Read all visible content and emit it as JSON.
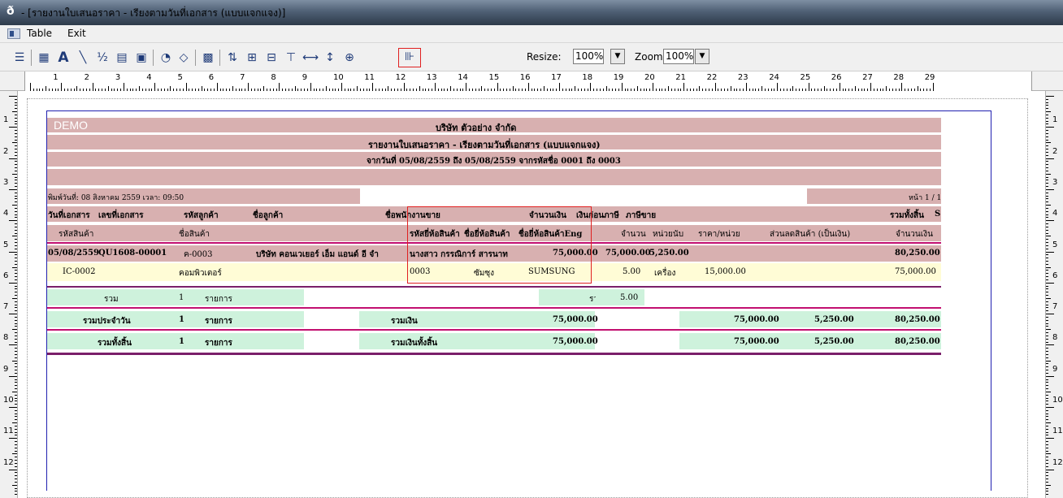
{
  "window": {
    "title": "- [รายงานใบเสนอราคา - เรียงตามวันที่เอกสาร (แบบแจกแจง)]"
  },
  "menu": {
    "items": [
      "Table",
      "Exit"
    ]
  },
  "toolbar": {
    "resize_label": "Resize:",
    "resize_value": "100%",
    "zoom_label": "Zoom:",
    "zoom_value": "100%",
    "icons": [
      "align-icon",
      "table-icon",
      "text-icon",
      "line-icon",
      "percent-icon",
      "grid-icon",
      "image-icon",
      "chart-icon",
      "eraser-icon",
      "picture-icon",
      "sort-icon",
      "group-icon",
      "field-icon",
      "column-icon",
      "width-icon",
      "height-icon",
      "fit-icon",
      "exit-icon"
    ]
  },
  "ruler": {
    "marks": [
      "1",
      "2",
      "3",
      "4",
      "5",
      "6",
      "7",
      "8",
      "9",
      "10",
      "11",
      "12",
      "13",
      "14",
      "15",
      "16",
      "17",
      "18",
      "19",
      "20",
      "21",
      "22",
      "23",
      "24",
      "25",
      "26",
      "27",
      "28",
      "29"
    ],
    "vmarks": [
      "1",
      "2",
      "3",
      "4",
      "5",
      "6",
      "7",
      "8",
      "9",
      "10",
      "11",
      "12"
    ]
  },
  "report": {
    "watermark": "DEMO",
    "company": "บริษัท ตัวอย่าง จำกัด",
    "title": "รายงานใบเสนอราคา - เรียงตามวันที่เอกสาร (แบบแจกแจง)",
    "range": "จากวันที่ 05/08/2559 ถึง 05/08/2559 จากรหัสชื่อ 0001 ถึง 0003",
    "print_date": "พิมพ์วันที่: 08 สิงหาคม 2559 เวลา: 09:50",
    "page": "หน้า 1 / 1",
    "header1": {
      "doc_date": "วันที่เอกสาร",
      "doc_no": "เลขที่เอกสาร",
      "cust_code": "รหัสลูกค้า",
      "cust_name": "ชื่อลูกค้า",
      "salesperson": "ชื่อพนักงานขาย",
      "amount": "จำนวนเงิน",
      "before_tax": "เงินก่อนภาษี",
      "tax": "ภาษีขาย",
      "total": "รวมทั้งสิ้น",
      "s": "S"
    },
    "header2": {
      "item_code": "รหัสสินค้า",
      "item_name": "ชื่อสินค้า",
      "brand_code": "รหัสยี่ห้อสินค้า",
      "brand_name": "ชื่อยี่ห้อสินค้า",
      "brand_name_eng": "ชื่อยี่ห้อสินค้าEng",
      "qty": "จำนวน",
      "unit": "หน่วยนับ",
      "price": "ราคา/หน่วย",
      "discount": "ส่วนลดสินค้า (เป็นเงิน)",
      "line_amount": "จำนวนเงิน"
    },
    "doc_row": {
      "date": "05/08/2559",
      "no": "QU1608-00001",
      "cust_code": "ค-0003",
      "cust_name": "บริษัท คอนเวเยอร์ เอ็ม แอนด์ อี จำ",
      "salesperson": "นางสาว กรรณิการ์ สารนาท",
      "amount": "75,000.00",
      "before_tax": "75,000.00",
      "tax": "5,250.00",
      "total": "80,250.00"
    },
    "item_row": {
      "code": "IC-0002",
      "name": "คอมพิวเตอร์",
      "brand_code": "0003",
      "brand_name": "ซัมซุง",
      "brand_name_eng": "SUMSUNG",
      "qty": "5.00",
      "unit": "เครื่อง",
      "price": "15,000.00",
      "amount": "75,000.00"
    },
    "sum_row": {
      "label": "รวม",
      "count": "1",
      "unit": "รายการ",
      "qty_label": "รวม",
      "qty": "5.00"
    },
    "daily_row": {
      "label": "รวมประจำวัน",
      "count": "1",
      "unit": "รายการ",
      "amount_label": "รวมเงิน",
      "amount": "75,000.00",
      "before_tax": "75,000.00",
      "tax": "5,250.00",
      "total": "80,250.00"
    },
    "grand_row": {
      "label": "รวมทั้งสิ้น",
      "count": "1",
      "unit": "รายการ",
      "amount_label": "รวมเงินทั้งสิ้น",
      "amount": "75,000.00",
      "before_tax": "75,000.00",
      "tax": "5,250.00",
      "total": "80,250.00"
    }
  },
  "colors": {
    "band": "#d8b0b0",
    "green": "#cef2dc",
    "yellow": "#fffcd6",
    "accent_line": "#c21070",
    "highlight_box": "#e02020"
  }
}
